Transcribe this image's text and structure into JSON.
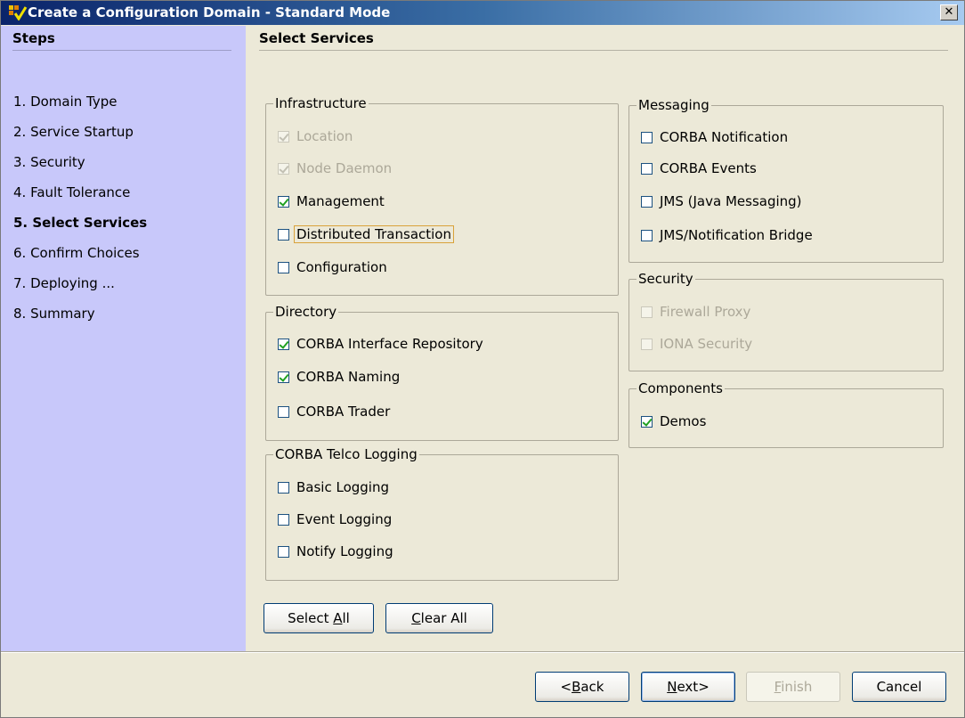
{
  "window": {
    "title": "Create a Configuration Domain - Standard Mode",
    "close_glyph": "✕"
  },
  "sidebar": {
    "title": "Steps",
    "steps": [
      {
        "label": "1. Domain Type",
        "active": false
      },
      {
        "label": "2. Service Startup",
        "active": false
      },
      {
        "label": "3. Security",
        "active": false
      },
      {
        "label": "4. Fault Tolerance",
        "active": false
      },
      {
        "label": "5. Select Services",
        "active": true
      },
      {
        "label": "6. Confirm Choices",
        "active": false
      },
      {
        "label": "7. Deploying ...",
        "active": false
      },
      {
        "label": "8. Summary",
        "active": false
      }
    ]
  },
  "main": {
    "title": "Select Services",
    "groups": {
      "infrastructure": {
        "label": "Infrastructure",
        "items": [
          {
            "label": "Location",
            "checked": true,
            "enabled": false
          },
          {
            "label": "Node Daemon",
            "checked": true,
            "enabled": false
          },
          {
            "label": "Management",
            "checked": true,
            "enabled": true
          },
          {
            "label": "Distributed Transaction",
            "checked": false,
            "enabled": true,
            "focused": true
          },
          {
            "label": "Configuration",
            "checked": false,
            "enabled": true
          }
        ]
      },
      "directory": {
        "label": "Directory",
        "items": [
          {
            "label": "CORBA Interface Repository",
            "checked": true,
            "enabled": true
          },
          {
            "label": "CORBA Naming",
            "checked": true,
            "enabled": true
          },
          {
            "label": "CORBA Trader",
            "checked": false,
            "enabled": true
          }
        ]
      },
      "telco": {
        "label": "CORBA Telco Logging",
        "items": [
          {
            "label": "Basic Logging",
            "checked": false,
            "enabled": true
          },
          {
            "label": "Event Logging",
            "checked": false,
            "enabled": true
          },
          {
            "label": "Notify Logging",
            "checked": false,
            "enabled": true
          }
        ]
      },
      "messaging": {
        "label": "Messaging",
        "items": [
          {
            "label": "CORBA Notification",
            "checked": false,
            "enabled": true
          },
          {
            "label": "CORBA Events",
            "checked": false,
            "enabled": true
          },
          {
            "label": "JMS (Java Messaging)",
            "checked": false,
            "enabled": true
          },
          {
            "label": "JMS/Notification Bridge",
            "checked": false,
            "enabled": true
          }
        ]
      },
      "security": {
        "label": "Security",
        "items": [
          {
            "label": "Firewall Proxy",
            "checked": false,
            "enabled": false
          },
          {
            "label": "IONA Security",
            "checked": false,
            "enabled": false
          }
        ]
      },
      "components": {
        "label": "Components",
        "items": [
          {
            "label": "Demos",
            "checked": true,
            "enabled": true
          }
        ]
      }
    },
    "select_all": {
      "pre": "Select ",
      "mnemonic": "A",
      "post": "ll"
    },
    "clear_all": {
      "pre": "",
      "mnemonic": "C",
      "post": "lear All"
    }
  },
  "footer": {
    "back": {
      "pre": "<",
      "mnemonic": "B",
      "post": "ack",
      "enabled": true
    },
    "next": {
      "pre": "",
      "mnemonic": "N",
      "post": "ext>",
      "enabled": true
    },
    "finish": {
      "pre": "",
      "mnemonic": "F",
      "post": "inish",
      "enabled": false
    },
    "cancel": {
      "label": "Cancel",
      "enabled": true
    }
  },
  "colors": {
    "sidebar_bg": "#c8c8fa",
    "dialog_bg": "#ece9d8",
    "check_mark": "#21a121",
    "titlebar_start": "#0a246a",
    "titlebar_end": "#a6caf0"
  }
}
